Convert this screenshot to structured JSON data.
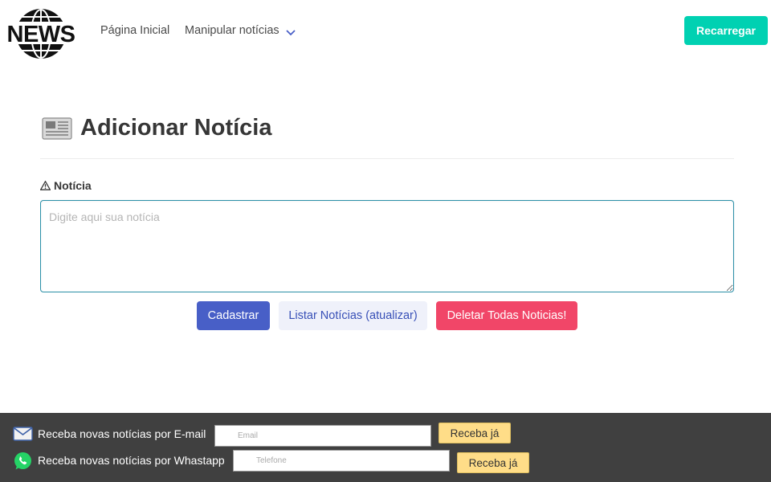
{
  "navbar": {
    "logo_text": "NEWS",
    "home_label": "Página Inicial",
    "manage_label": "Manipular notícias",
    "reload_label": "Recarregar"
  },
  "main": {
    "title": "Adicionar Notícia",
    "field_label": "Notícia",
    "textarea_value": "",
    "textarea_placeholder": "Digite aqui sua notícia",
    "buttons": {
      "submit": "Cadastrar",
      "list": "Listar Notícias (atualizar)",
      "delete_all": "Deletar Todas Noticias!"
    }
  },
  "footer": {
    "email_text": "Receba novas notícias por E-mail",
    "email_placeholder": "Email",
    "email_button": "Receba já",
    "whatsapp_text": "Receba novas notícias por Whastapp",
    "phone_placeholder": "Telefone",
    "phone_button": "Receba já"
  },
  "colors": {
    "primary": "#485fc7",
    "reload": "#00d1b2",
    "danger": "#f14668",
    "light": "#eff1fa",
    "footer_bg": "#404040",
    "footer_button": "#ffdd88"
  }
}
